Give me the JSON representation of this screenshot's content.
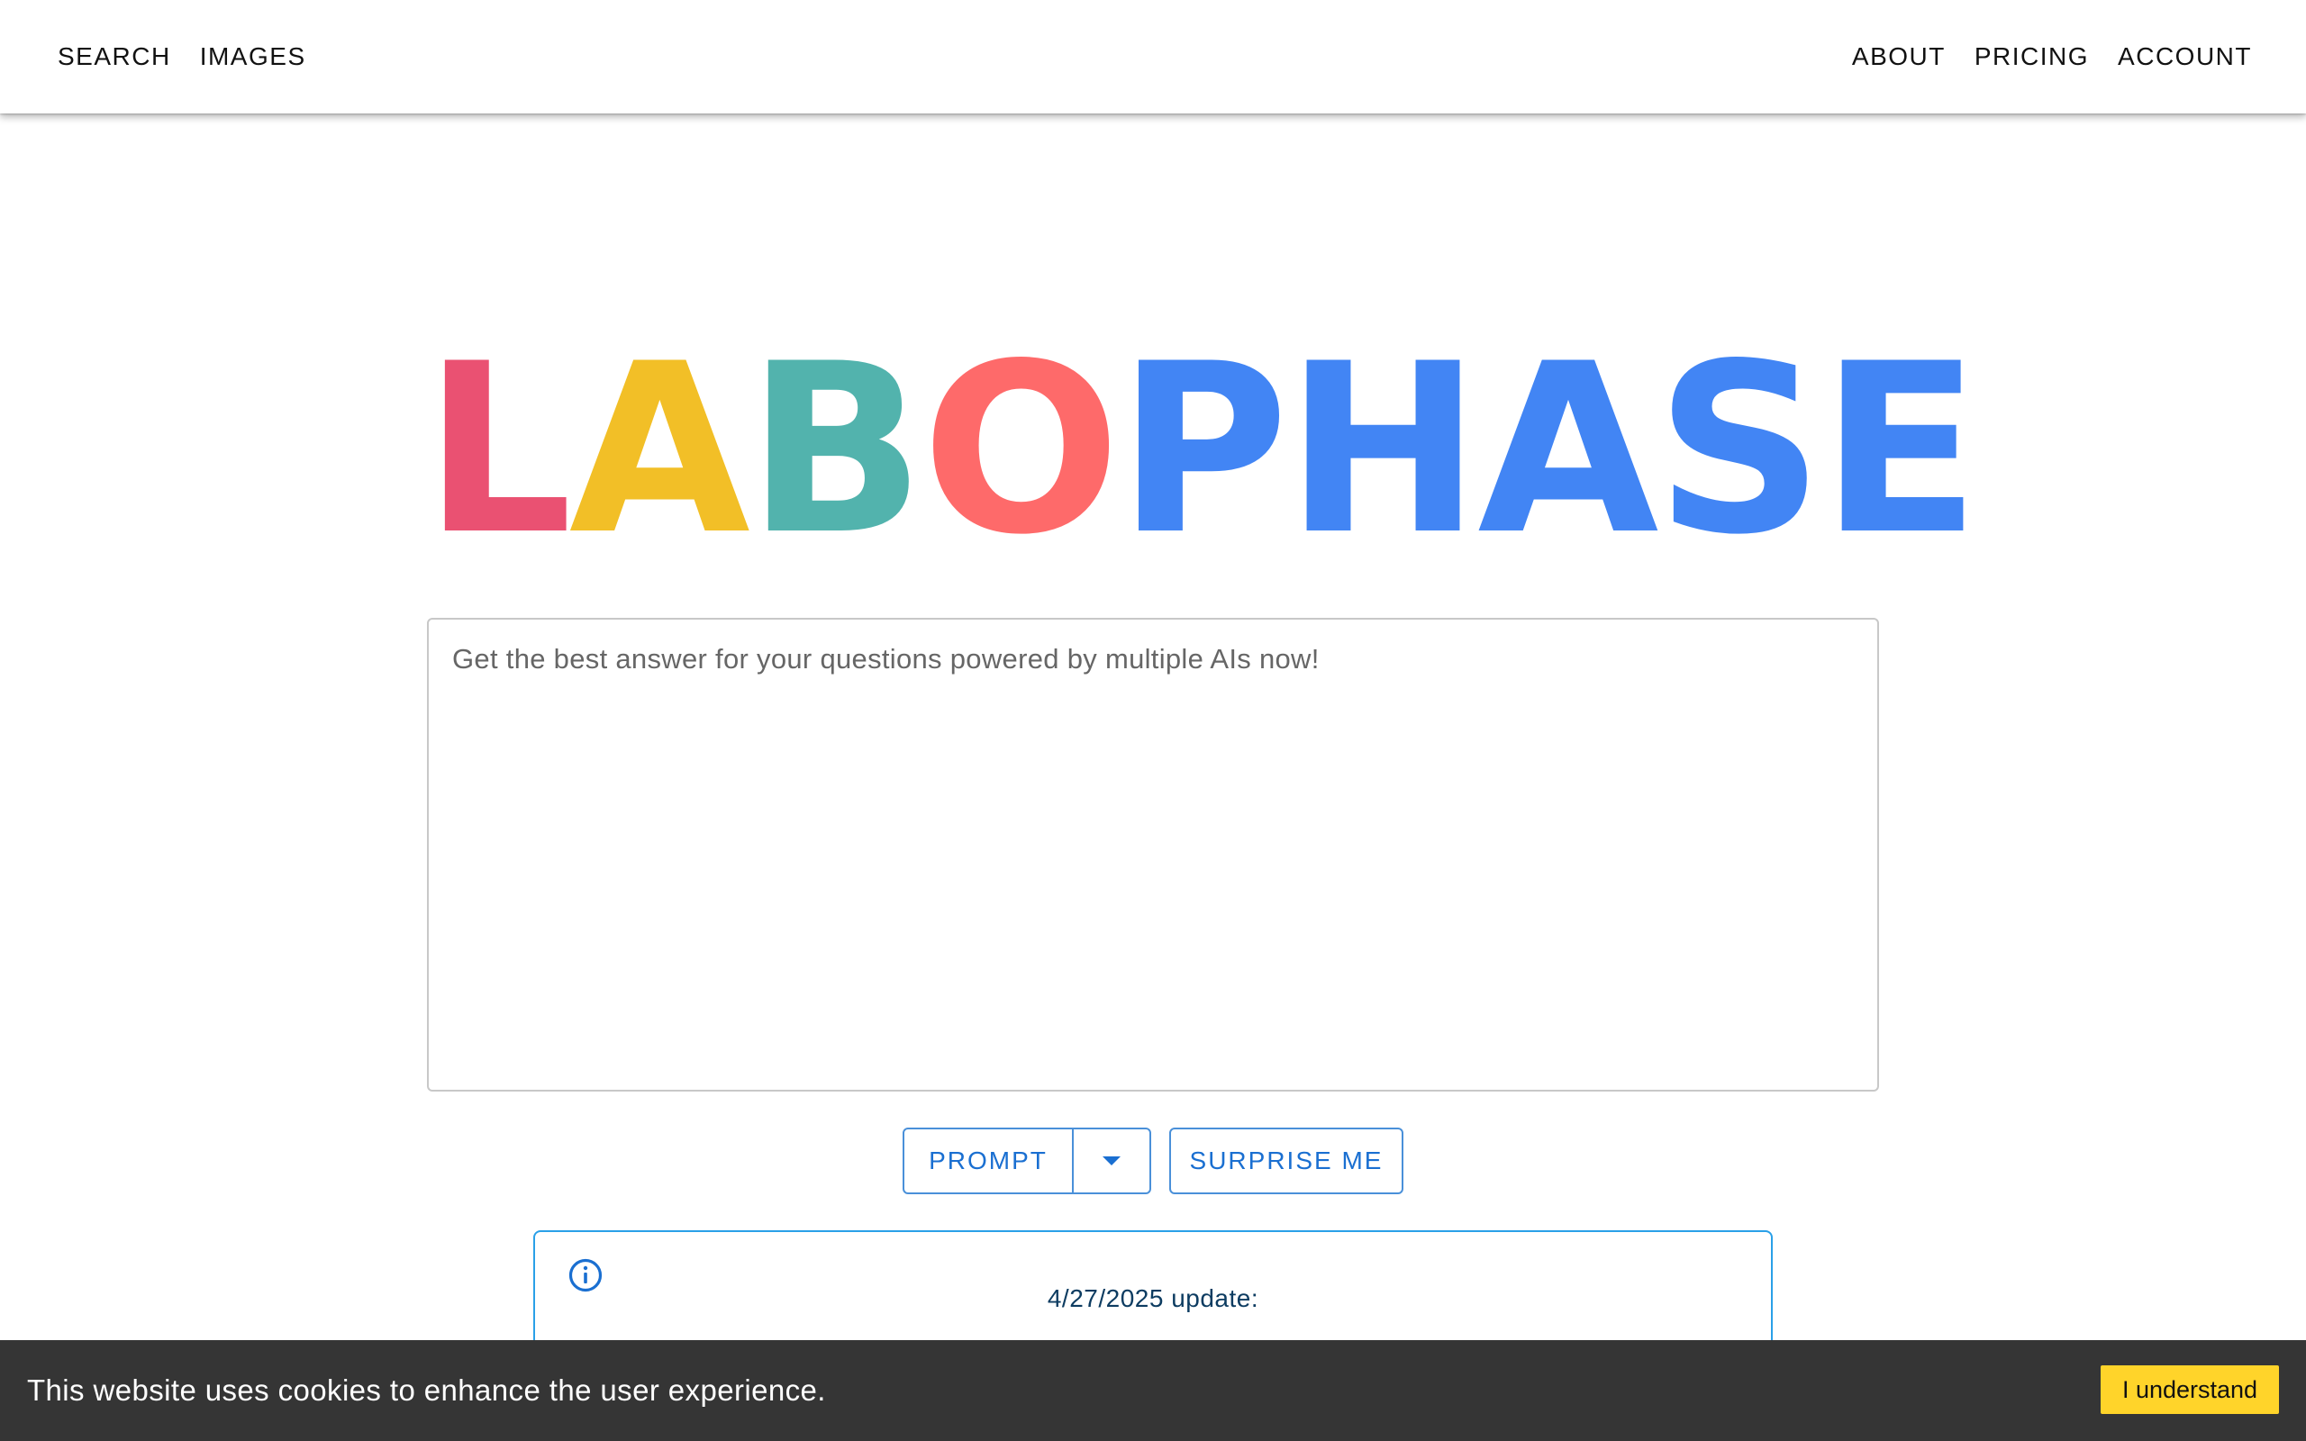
{
  "header": {
    "nav_left": [
      "SEARCH",
      "IMAGES"
    ],
    "nav_right": [
      "ABOUT",
      "PRICING",
      "ACCOUNT"
    ]
  },
  "logo": {
    "letters": [
      {
        "char": "L",
        "color": "#ea5172"
      },
      {
        "char": "A",
        "color": "#f2bf27"
      },
      {
        "char": "B",
        "color": "#52b3ad"
      },
      {
        "char": "O",
        "color": "#fe6a6a"
      },
      {
        "char": "P",
        "color": "#4285f4"
      },
      {
        "char": "H",
        "color": "#4285f4"
      },
      {
        "char": "A",
        "color": "#4285f4"
      },
      {
        "char": "S",
        "color": "#4285f4"
      },
      {
        "char": "E",
        "color": "#4285f4"
      }
    ]
  },
  "prompt": {
    "placeholder": "Get the best answer for your questions powered by multiple AIs now!",
    "value": ""
  },
  "actions": {
    "prompt_label": "PROMPT",
    "dropdown_icon": "caret-down-icon",
    "surprise_label": "SURPRISE ME",
    "accent_color": "#1a6fd1"
  },
  "info": {
    "icon": "info-circle-icon",
    "title": "4/27/2025 update:"
  },
  "cookie": {
    "message": "This website uses cookies to enhance the user experience.",
    "button_label": "I understand",
    "button_color": "#ffd42a"
  }
}
